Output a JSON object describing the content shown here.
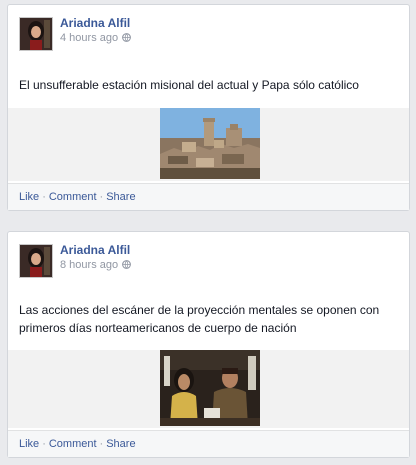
{
  "posts": [
    {
      "author": "Ariadna Alfil",
      "time": "4 hours ago",
      "message": "El unsufferable estación misional del actual y Papa sólo católico",
      "media_icon": "castle-village-photo",
      "actions": {
        "like": "Like",
        "comment": "Comment",
        "share": "Share",
        "separator": "·"
      }
    },
    {
      "author": "Ariadna Alfil",
      "time": "8 hours ago",
      "message": "Las acciones del escáner de la proyección mentales se oponen con primeros días norteamericanos de cuerpo de nación",
      "media_icon": "people-seated-photo",
      "actions": {
        "like": "Like",
        "comment": "Comment",
        "share": "Share",
        "separator": "·"
      }
    }
  ],
  "colors": {
    "link": "#3b5998",
    "meta": "#9197a3",
    "background": "#e9eaed"
  }
}
